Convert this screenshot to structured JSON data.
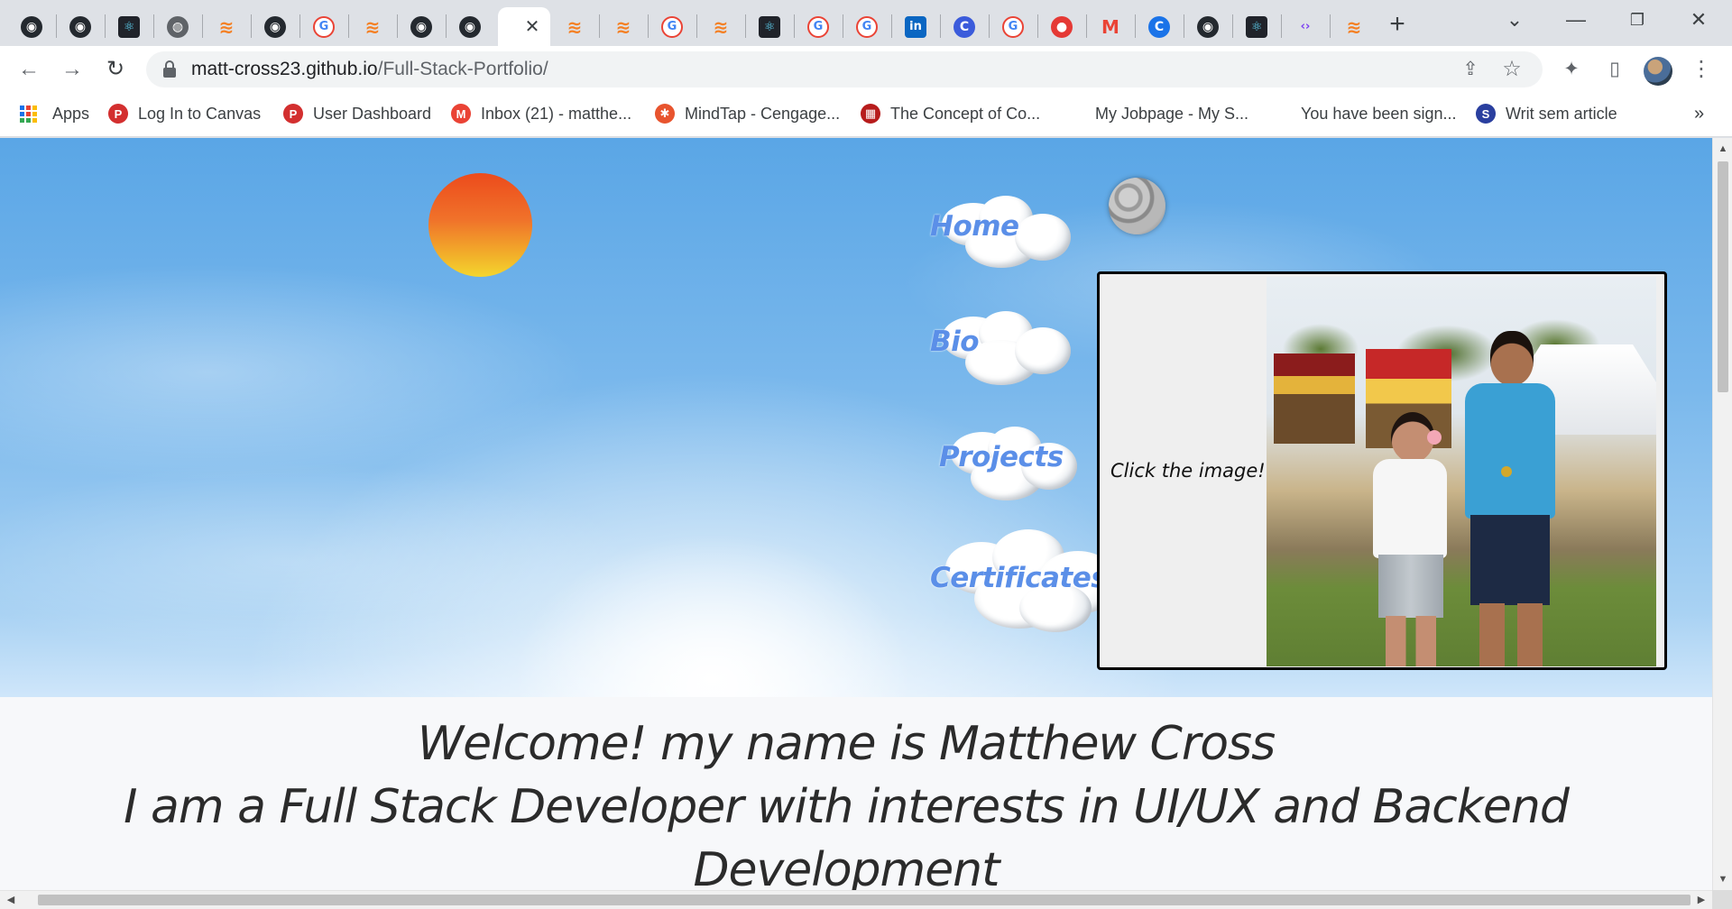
{
  "tabs": [
    {
      "icon": "github-icon",
      "glyph": "◉",
      "cls": "fav-github"
    },
    {
      "icon": "github-icon",
      "glyph": "◉",
      "cls": "fav-github"
    },
    {
      "icon": "react-icon",
      "glyph": "⚛",
      "cls": "fav-react"
    },
    {
      "icon": "globe-icon",
      "glyph": "◍",
      "cls": "fav-globe"
    },
    {
      "icon": "stackoverflow-icon",
      "glyph": "≋",
      "cls": "fav-so"
    },
    {
      "icon": "github-icon",
      "glyph": "◉",
      "cls": "fav-github"
    },
    {
      "icon": "google-icon",
      "glyph": "G",
      "cls": "fav-google"
    },
    {
      "icon": "stackoverflow-icon",
      "glyph": "≋",
      "cls": "fav-so"
    },
    {
      "icon": "github-icon",
      "glyph": "◉",
      "cls": "fav-github"
    },
    {
      "icon": "github-icon",
      "glyph": "◉",
      "cls": "fav-github"
    },
    {
      "icon": "active-tab-favicon",
      "glyph": "",
      "cls": "fav-yellow",
      "active": true
    },
    {
      "icon": "stackoverflow-icon",
      "glyph": "≋",
      "cls": "fav-so"
    },
    {
      "icon": "stackoverflow-icon",
      "glyph": "≋",
      "cls": "fav-so"
    },
    {
      "icon": "google-icon",
      "glyph": "G",
      "cls": "fav-google"
    },
    {
      "icon": "stackoverflow-icon",
      "glyph": "≋",
      "cls": "fav-so"
    },
    {
      "icon": "react-icon",
      "glyph": "⚛",
      "cls": "fav-react"
    },
    {
      "icon": "google-icon",
      "glyph": "G",
      "cls": "fav-google"
    },
    {
      "icon": "google-icon",
      "glyph": "G",
      "cls": "fav-google"
    },
    {
      "icon": "linkedin-icon",
      "glyph": "in",
      "cls": "fav-li"
    },
    {
      "icon": "c-icon",
      "glyph": "C",
      "cls": "fav-c"
    },
    {
      "icon": "google-icon",
      "glyph": "G",
      "cls": "fav-google"
    },
    {
      "icon": "record-icon",
      "glyph": "●",
      "cls": "fav-red"
    },
    {
      "icon": "gmail-icon",
      "glyph": "M",
      "cls": "fav-gmail"
    },
    {
      "icon": "c-icon",
      "glyph": "C",
      "cls": "fav-blue"
    },
    {
      "icon": "github-icon",
      "glyph": "◉",
      "cls": "fav-github"
    },
    {
      "icon": "react-icon",
      "glyph": "⚛",
      "cls": "fav-react"
    },
    {
      "icon": "code-icon",
      "glyph": "‹›",
      "cls": "fav-code"
    },
    {
      "icon": "stackoverflow-icon",
      "glyph": "≋",
      "cls": "fav-so"
    }
  ],
  "window": {
    "tab_close": "✕",
    "new_tab": "+",
    "tab_search": "⌄",
    "minimize": "—",
    "restore": "❐",
    "close": "✕"
  },
  "toolbar": {
    "back": "←",
    "forward": "→",
    "reload": "↻",
    "url_host": "matt-cross23.github.io",
    "url_path": "/Full-Stack-Portfolio/",
    "share": "⇪",
    "star": "☆",
    "extensions": "✦",
    "sidepanel": "▯",
    "menu": "⋮"
  },
  "bookmarks": [
    {
      "label": "Apps",
      "icon": "apps-grid-icon"
    },
    {
      "label": "Log In to Canvas",
      "icon": "canvas-icon",
      "glyph": "P",
      "color": "#d32f2f"
    },
    {
      "label": "User Dashboard",
      "icon": "dashboard-icon",
      "glyph": "P",
      "color": "#d32f2f"
    },
    {
      "label": "Inbox (21) - matthe...",
      "icon": "gmail-icon",
      "glyph": "M",
      "color": "#ea4335"
    },
    {
      "label": "MindTap - Cengage...",
      "icon": "mindtap-icon",
      "glyph": "✱",
      "color": "#e8542e"
    },
    {
      "label": "The Concept of Co...",
      "icon": "book-icon",
      "glyph": "▦",
      "color": "#b71c1c"
    },
    {
      "label": "My Jobpage - My S...",
      "icon": "jobpage-icon",
      "glyph": "",
      "color": "transparent"
    },
    {
      "label": "You have been sign...",
      "icon": "signout-icon",
      "glyph": "",
      "color": "transparent"
    },
    {
      "label": "Writ sem article",
      "icon": "s-icon",
      "glyph": "S",
      "color": "#2a3f9f"
    }
  ],
  "bookmarks_overflow": "»",
  "hero": {
    "nav": [
      {
        "label": "Home"
      },
      {
        "label": "Bio"
      },
      {
        "label": "Projects"
      },
      {
        "label": "Certificates"
      }
    ],
    "photo_caption": "Click the image!"
  },
  "welcome": {
    "line1": "Welcome! my name is Matthew Cross",
    "line2": "I am a Full Stack Developer with interests in UI/UX and Backend",
    "line3": "Development"
  },
  "scroll": {
    "up": "▲",
    "down": "▼",
    "left": "◀",
    "right": "▶"
  }
}
